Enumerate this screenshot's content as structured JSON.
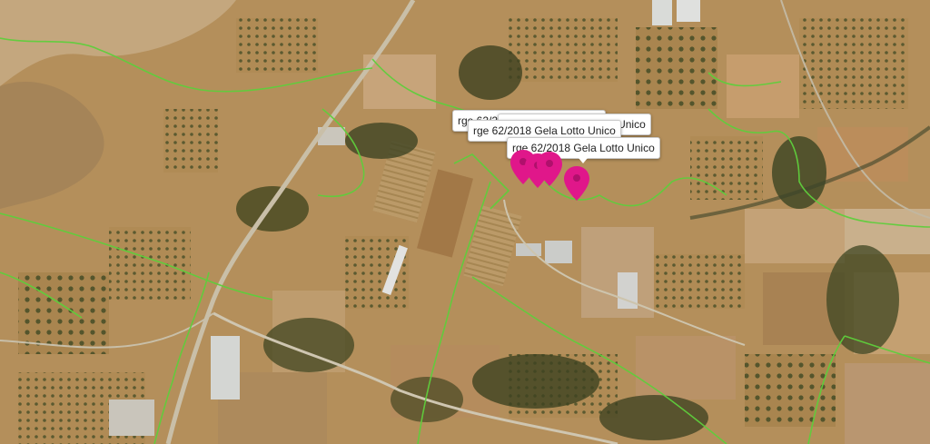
{
  "map": {
    "type": "satellite",
    "boundary_line_color": "#5fce3c",
    "marker_color": "#e0178a"
  },
  "markers": [
    {
      "label": "rge 62/2018 Gela Lotto Unico"
    },
    {
      "label": "rge 62/2018 Gela Lotto Unico"
    },
    {
      "label": "rge 62/2018 Gela Lotto Unico"
    },
    {
      "label": "rge 62/2018 Gela Lotto Unico"
    }
  ]
}
